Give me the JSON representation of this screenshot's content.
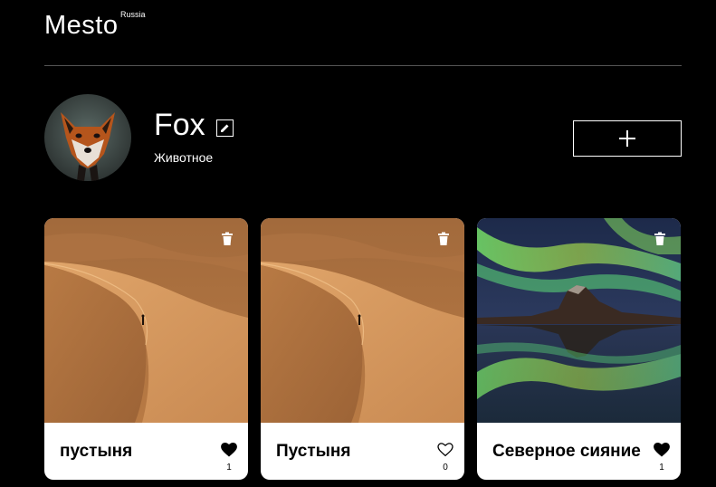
{
  "header": {
    "logo": "Mesto",
    "logo_sub": "Russia"
  },
  "profile": {
    "name": "Fox",
    "about": "Животное"
  },
  "cards": [
    {
      "title": "пустыня",
      "likes": "1",
      "liked": true,
      "image": "desert"
    },
    {
      "title": "Пустыня",
      "likes": "0",
      "liked": false,
      "image": "desert"
    },
    {
      "title": "Северное сияние",
      "likes": "1",
      "liked": true,
      "image": "aurora"
    }
  ],
  "icons": {
    "edit": "pencil-icon",
    "add": "plus-icon",
    "trash": "trash-icon",
    "like": "heart-icon"
  },
  "colors": {
    "background": "#000000",
    "card": "#ffffff",
    "text_on_card": "#000000"
  }
}
